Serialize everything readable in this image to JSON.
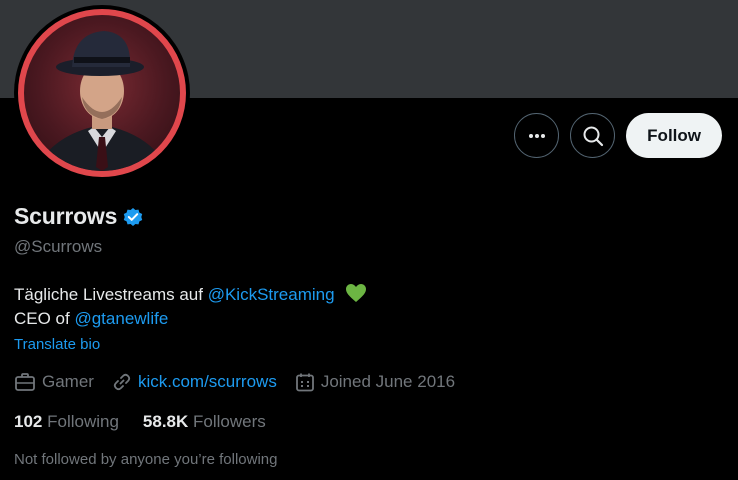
{
  "profile": {
    "name": "Scurrows",
    "handle": "@Scurrows",
    "bio_line1_text": "Tägliche Livestreams auf ",
    "bio_line1_mention": "@KickStreaming",
    "bio_line1_emoji": "💚",
    "bio_line2_text": "CEO of ",
    "bio_line2_mention": "@gtanewlife",
    "translate_label": "Translate bio"
  },
  "actions": {
    "more_icon": "more-horizontal-icon",
    "search_icon": "search-icon",
    "follow_label": "Follow"
  },
  "meta": {
    "category": "Gamer",
    "website": "kick.com/scurrows",
    "joined": "Joined June 2016"
  },
  "stats": {
    "following_count": "102",
    "following_label": "Following",
    "followers_count": "58.8K",
    "followers_label": "Followers"
  },
  "followed_by": "Not followed by anyone you’re following",
  "colors": {
    "background": "#000000",
    "banner": "#333639",
    "accent": "#1d9bf0",
    "avatar_ring": "#e0474c",
    "muted": "#71767b"
  }
}
